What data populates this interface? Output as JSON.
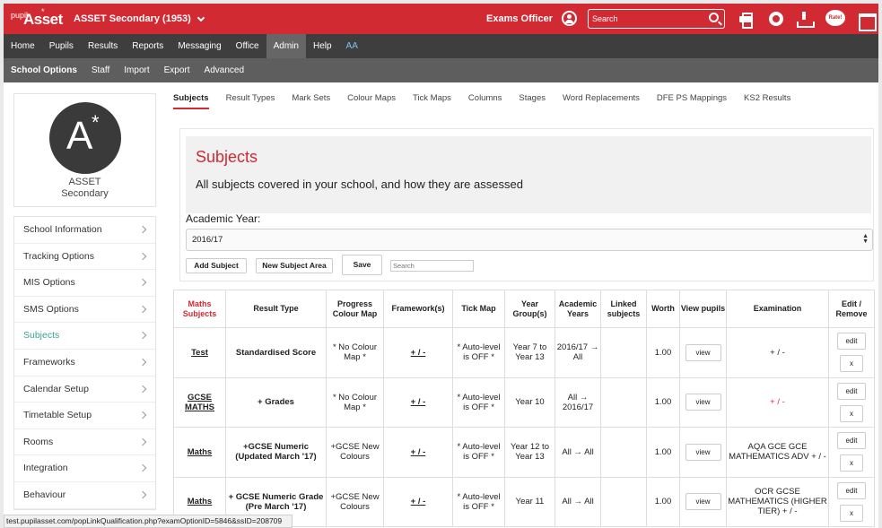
{
  "header": {
    "logo_pupil": "pupil",
    "logo_asset": "Asset",
    "logo_star": "*",
    "school": "ASSET Secondary (1953)",
    "role": "Exams Officer",
    "search_placeholder": "Search",
    "chat_label": "Rate!"
  },
  "nav_main": [
    "Home",
    "Pupils",
    "Results",
    "Reports",
    "Messaging",
    "Office",
    "Admin",
    "Help",
    "AA"
  ],
  "nav_sub": [
    "School Options",
    "Staff",
    "Import",
    "Export",
    "Advanced"
  ],
  "school_card": {
    "letter": "A",
    "star": "*",
    "name_line1": "ASSET",
    "name_line2": "Secondary"
  },
  "sidebar": [
    "School Information",
    "Tracking Options",
    "MIS Options",
    "SMS Options",
    "Subjects",
    "Frameworks",
    "Calendar Setup",
    "Timetable Setup",
    "Rooms",
    "Integration",
    "Behaviour"
  ],
  "tabs": [
    "Subjects",
    "Result Types",
    "Mark Sets",
    "Colour Maps",
    "Tick Maps",
    "Columns",
    "Stages",
    "Word Replacements",
    "DFE PS Mappings",
    "KS2 Results"
  ],
  "panel": {
    "title": "Subjects",
    "subtitle": "All subjects covered in your school, and how they are assessed",
    "ay_label": "Academic Year:",
    "ay_value": "2016/17",
    "add_subject": "Add Subject",
    "new_area": "New Subject Area",
    "save": "Save",
    "search_placeholder": "Search"
  },
  "table": {
    "headers": [
      "Maths Subjects",
      "Result Type",
      "Progress Colour Map",
      "Framework(s)",
      "Tick Map",
      "Year Group(s)",
      "Academic Years",
      "Linked subjects",
      "Worth",
      "View pupils",
      "Examination",
      "Edit / Remove"
    ],
    "rows": [
      {
        "subject": "Test",
        "result_type": "Standardised Score",
        "colour_map": "* No Colour Map *",
        "framework": "+ / -",
        "tick_map": "* Auto-level is OFF *",
        "year_groups": "Year 7 to Year 13",
        "academic_years": "2016/17 → All",
        "linked": "",
        "worth": "1.00",
        "view": "view",
        "examination": "+ / -",
        "edit": "edit",
        "remove": "x"
      },
      {
        "subject": "GCSE MATHS",
        "result_type": "+ Grades",
        "colour_map": "* No Colour Map *",
        "framework": "+ / -",
        "tick_map": "* Auto-level is OFF *",
        "year_groups": "Year 10",
        "academic_years": "All → 2016/17",
        "linked": "",
        "worth": "1.00",
        "view": "view",
        "examination": "+ / -",
        "edit": "edit",
        "remove": "x"
      },
      {
        "subject": "Maths",
        "result_type": "+GCSE Numeric (Updated March '17)",
        "colour_map": "+GCSE New Colours",
        "framework": "+ / -",
        "tick_map": "* Auto-level is OFF *",
        "year_groups": "Year 12 to Year 13",
        "academic_years": "All → All",
        "linked": "",
        "worth": "1.00",
        "view": "view",
        "examination": "AQA GCE GCE MATHEMATICS ADV + / -",
        "edit": "edit",
        "remove": "x"
      },
      {
        "subject": "Maths",
        "result_type": "+ GCSE Numeric Grade (Pre March '17)",
        "colour_map": "+GCSE New Colours",
        "framework": "+ / -",
        "tick_map": "* Auto-level is OFF *",
        "year_groups": "Year 11",
        "academic_years": "All → All",
        "linked": "",
        "worth": "1.00",
        "view": "view",
        "examination": "OCR GCSE MATHEMATICS (HIGHER TIER) + / -",
        "edit": "edit",
        "remove": "x"
      }
    ]
  },
  "status_url": "test.pupilasset.com/popLinkQualification.php?examOptionID=5846&ssID=208709"
}
